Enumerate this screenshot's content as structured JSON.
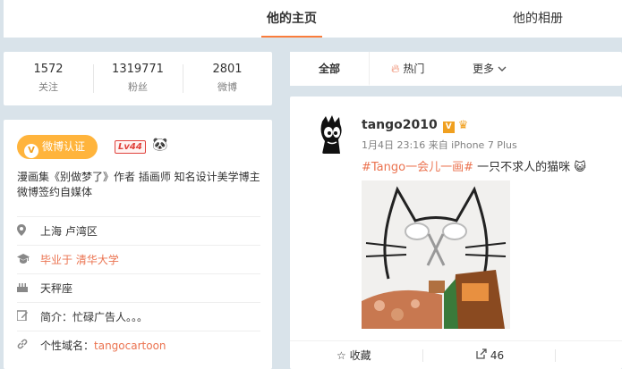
{
  "topnav": {
    "tab_home": "他的主页",
    "tab_album": "他的相册"
  },
  "stats": [
    {
      "num": "1572",
      "label": "关注"
    },
    {
      "num": "1319771",
      "label": "粉丝"
    },
    {
      "num": "2801",
      "label": "微博"
    }
  ],
  "profile": {
    "verify_label": "微博认证",
    "level": "Lv44",
    "description": "漫画集《别做梦了》作者 插画师 知名设计美学博主 微博签约自媒体",
    "location": "上海 卢湾区",
    "school_prefix": "毕业于",
    "school": "清华大学",
    "zodiac": "天秤座",
    "intro": "简介：忙碌广告人。。。",
    "domain_prefix": "个性域名：",
    "domain": "tangocartoon"
  },
  "feed_tabs": {
    "all": "全部",
    "hot": "热门",
    "more": "更多"
  },
  "post": {
    "username": "tango2010",
    "time": "1月4日 23:16 来自 iPhone 7 Plus",
    "tag": "#Tango一会儿一画#",
    "text": " 一只不求人的猫咪",
    "action_fav": "收藏",
    "action_share_count": "46"
  },
  "colors": {
    "accent": "#eb7350",
    "orange_badge": "#ffb43c",
    "level_red": "#e0423c",
    "bg": "#d9e3ea"
  }
}
